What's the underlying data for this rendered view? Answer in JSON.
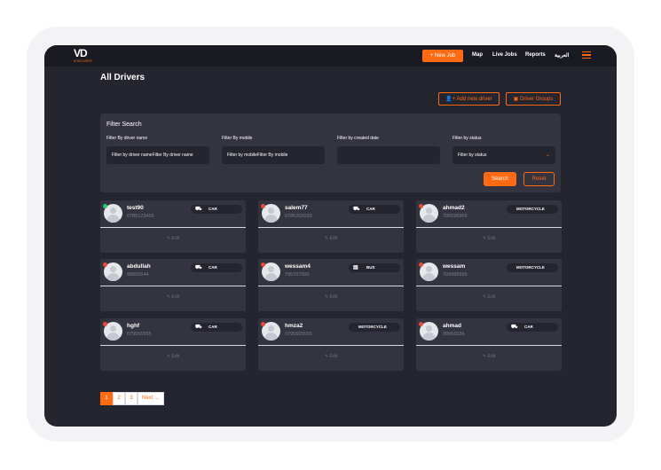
{
  "app": {
    "logo_text": "VD",
    "logo_sub": "M DELIVERY"
  },
  "nav": {
    "new_job": "+ New Job",
    "links": [
      "Map",
      "Live Jobs",
      "Reports",
      "العربية"
    ]
  },
  "page": {
    "title": "All Drivers",
    "add_driver": "Add new driver",
    "driver_groups": "Driver Groups"
  },
  "filter": {
    "title": "Filter Search",
    "name_label": "Filter By driver name",
    "name_value": "Filter by driver nameFilter By driver name",
    "mobile_label": "Filter By mobile",
    "mobile_value": "Filter by mobileFilter By mobile",
    "date_label": "Filter by created date",
    "date_value": "",
    "status_label": "Filter by status",
    "status_value": "Filter by status",
    "search": "Search",
    "reset": "Reset"
  },
  "drivers": [
    {
      "name": "test90",
      "phone": "0785123456",
      "vehicle": "CAR",
      "icon": "car-icon",
      "status_color": "#2ecc71"
    },
    {
      "name": "salem77",
      "phone": "0785202020",
      "vehicle": "CAR",
      "icon": "car-icon",
      "status_color": "#e74c3c"
    },
    {
      "name": "ahmad2",
      "phone": "795696969",
      "vehicle": "MOTORCYCLE",
      "icon": "motorcycle-icon",
      "status_color": "#e74c3c"
    },
    {
      "name": "abdullah",
      "phone": "99665544",
      "vehicle": "CAR",
      "icon": "car-icon",
      "status_color": "#e74c3c"
    },
    {
      "name": "wessam4",
      "phone": "795707000",
      "vehicle": "BUS",
      "icon": "bus-icon",
      "status_color": "#e74c3c"
    },
    {
      "name": "wessam",
      "phone": "799999999",
      "vehicle": "MOTORCYCLE",
      "icon": "motorcycle-icon",
      "status_color": "#e74c3c"
    },
    {
      "name": "hghf",
      "phone": "079555555",
      "vehicle": "CAR",
      "icon": "car-icon",
      "status_color": "#e74c3c"
    },
    {
      "name": "hmza2",
      "phone": "0795555555",
      "vehicle": "MOTORCYCLE",
      "icon": "motorcycle-icon",
      "status_color": "#e74c3c"
    },
    {
      "name": "ahmad",
      "phone": "99966636",
      "vehicle": "CAR",
      "icon": "car-icon",
      "status_color": "#e74c3c"
    }
  ],
  "edit_label": "Edit",
  "pagination": {
    "pages": [
      "1",
      "2",
      "3"
    ],
    "next": "Next →",
    "active": "1"
  },
  "colors": {
    "accent": "#ff6a13",
    "background": "#24252e",
    "card": "#33343f"
  }
}
